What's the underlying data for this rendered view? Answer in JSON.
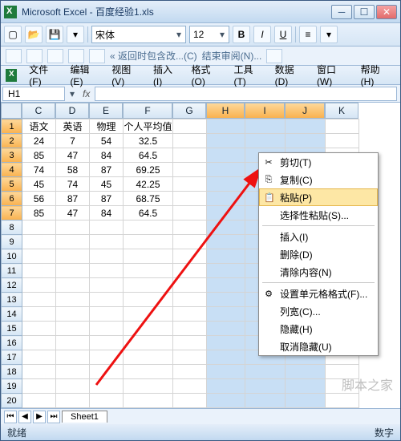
{
  "window": {
    "title": "Microsoft Excel - 百度经验1.xls"
  },
  "font": {
    "name": "宋体",
    "size": "12"
  },
  "toolbar": {
    "bold": "B",
    "italic": "I",
    "underline": "U"
  },
  "review": {
    "back_include": "« 返回时包含改...(C)",
    "end_review": "结束审阅(N)..."
  },
  "menu": {
    "file": "文件(F)",
    "edit": "编辑(E)",
    "view": "视图(V)",
    "insert": "插入(I)",
    "format": "格式(O)",
    "tools": "工具(T)",
    "data": "数据(D)",
    "window": "窗口(W)",
    "help": "帮助(H)"
  },
  "namebox": {
    "cell": "H1"
  },
  "columns": {
    "C": "C",
    "D": "D",
    "E": "E",
    "F": "F",
    "G": "G",
    "H": "H",
    "I": "I",
    "J": "J",
    "K": "K"
  },
  "rows": [
    "1",
    "2",
    "3",
    "4",
    "5",
    "6",
    "7",
    "8",
    "9",
    "10",
    "11",
    "12",
    "13",
    "14",
    "15",
    "16",
    "17",
    "18",
    "19",
    "20"
  ],
  "headers": {
    "C": "语文",
    "D": "英语",
    "E": "物理",
    "F": "个人平均值"
  },
  "data": [
    {
      "C": "24",
      "D": "7",
      "E": "54",
      "F": "32.5"
    },
    {
      "C": "85",
      "D": "47",
      "E": "84",
      "F": "64.5"
    },
    {
      "C": "74",
      "D": "58",
      "E": "87",
      "F": "69.25"
    },
    {
      "C": "45",
      "D": "74",
      "E": "45",
      "F": "42.25"
    },
    {
      "C": "56",
      "D": "87",
      "E": "87",
      "F": "68.75"
    },
    {
      "C": "85",
      "D": "47",
      "E": "84",
      "F": "64.5"
    }
  ],
  "context_menu": {
    "cut": "剪切(T)",
    "copy": "复制(C)",
    "paste": "粘贴(P)",
    "paste_special": "选择性粘贴(S)...",
    "insert": "插入(I)",
    "delete": "删除(D)",
    "clear": "清除内容(N)",
    "format_cells": "设置单元格格式(F)...",
    "col_width": "列宽(C)...",
    "hide": "隐藏(H)",
    "unhide": "取消隐藏(U)"
  },
  "tabs": {
    "sheet1": "Sheet1"
  },
  "status": {
    "ready": "就绪",
    "num": "数字"
  },
  "watermark": "脚本之家"
}
